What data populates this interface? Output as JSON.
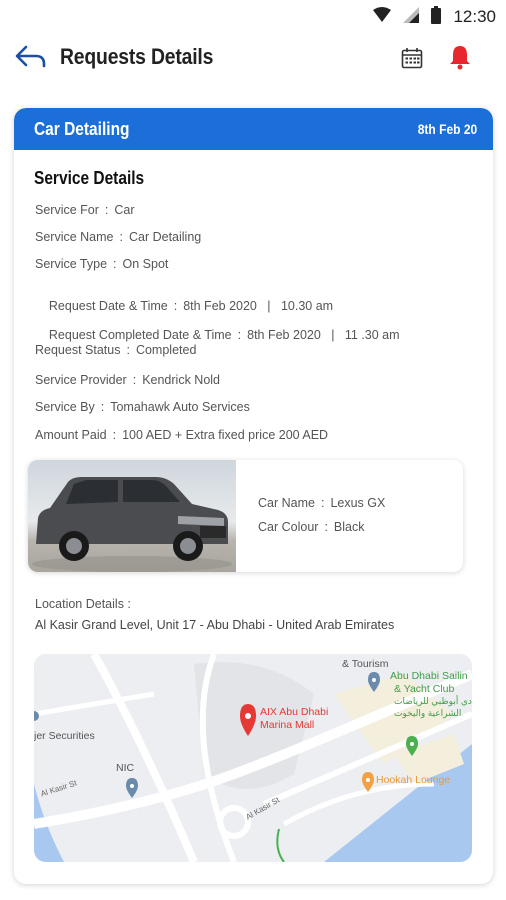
{
  "status_bar": {
    "time": "12:30"
  },
  "header": {
    "title": "Requests Details"
  },
  "card": {
    "service_title": "Car Detailing",
    "date": "8th Feb 20",
    "section_title": "Service Details",
    "details": [
      {
        "label": "Service For",
        "value": "Car"
      },
      {
        "label": "Service Name",
        "value": "Car Detailing"
      },
      {
        "label": "Service Type",
        "value": "On Spot"
      },
      {
        "label": "Request Date & Time",
        "value": "8th Feb 2020   |   10.30 am"
      },
      {
        "label": "Request Completed Date & Time",
        "value": "8th Feb 2020   |   11 .30 am"
      },
      {
        "label": "Request Status",
        "value": "Completed"
      },
      {
        "label": "Service Provider",
        "value": "Kendrick Nold"
      },
      {
        "label": "Service By",
        "value": "Tomahawk Auto Services"
      },
      {
        "label": "Amount Paid",
        "value": "100 AED + Extra fixed price 200 AED"
      }
    ],
    "car": {
      "name_label": "Car Name",
      "name_value": "Lexus GX",
      "colour_label": "Car Colour",
      "colour_value": "Black"
    },
    "location": {
      "label": "Location Details  :",
      "value": "Al Kasir Grand Level, Unit 17 - Abu Dhabi - United Arab Emirates"
    },
    "map": {
      "labels": {
        "tourism": "& Tourism",
        "sailing_1": "Abu Dhabi Sailin",
        "sailing_2": "& Yacht Club",
        "arabic_1": "نادي أبوظبي للرياضات",
        "arabic_2": "الشراعية واليخوت",
        "mall_1": "AIX Abu Dhabi",
        "mall_2": "Marina Mall",
        "securities": "jer Securities",
        "nic": "NIC",
        "hookah": "Hookah Lounge",
        "street_1": "Al Kasir St",
        "street_2": "Al Kasir St"
      },
      "colors": {
        "pin": "#e53935",
        "water": "#a8c8f0",
        "road": "#ffffff",
        "poi_blue": "#6b8bad",
        "poi_green": "#4caf50",
        "poi_orange": "#f4a143"
      }
    }
  },
  "colors": {
    "accent": "#1c6fd9",
    "bell": "#e8262d",
    "back_arrow": "#1c4fa0"
  }
}
